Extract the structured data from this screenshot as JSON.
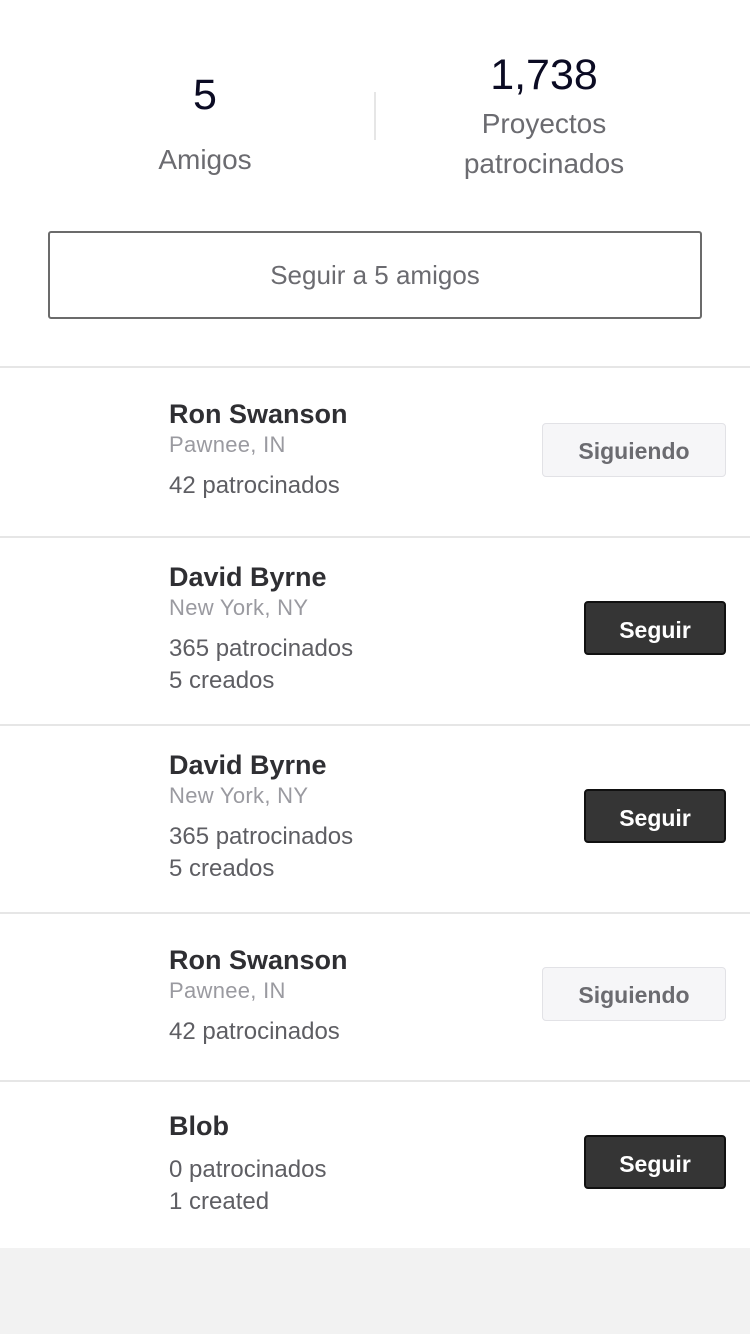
{
  "stats": {
    "friends": {
      "value": "5",
      "label": "Amigos"
    },
    "projects": {
      "value": "1,738",
      "label_line1": "Proyectos",
      "label_line2": "patrocinados"
    }
  },
  "follow_all_label": "Seguir a 5 amigos",
  "friends": [
    {
      "name": "Ron Swanson",
      "location": "Pawnee, IN",
      "stats": [
        "42 patrocinados"
      ],
      "button": "Siguiendo",
      "following": true
    },
    {
      "name": "David Byrne",
      "location": "New York, NY",
      "stats": [
        "365 patrocinados",
        "5 creados"
      ],
      "button": "Seguir",
      "following": false
    },
    {
      "name": "David Byrne",
      "location": "New York, NY",
      "stats": [
        "365 patrocinados",
        "5 creados"
      ],
      "button": "Seguir",
      "following": false
    },
    {
      "name": "Ron Swanson",
      "location": "Pawnee, IN",
      "stats": [
        "42 patrocinados"
      ],
      "button": "Siguiendo",
      "following": true
    },
    {
      "name": "Blob",
      "stats": [
        "0 patrocinados",
        "1 created"
      ],
      "button": "Seguir",
      "following": false
    }
  ],
  "colors": {
    "follow_button_bg": "#353535",
    "following_button_bg": "#f6f6f8",
    "background": "#f2f2f2"
  }
}
